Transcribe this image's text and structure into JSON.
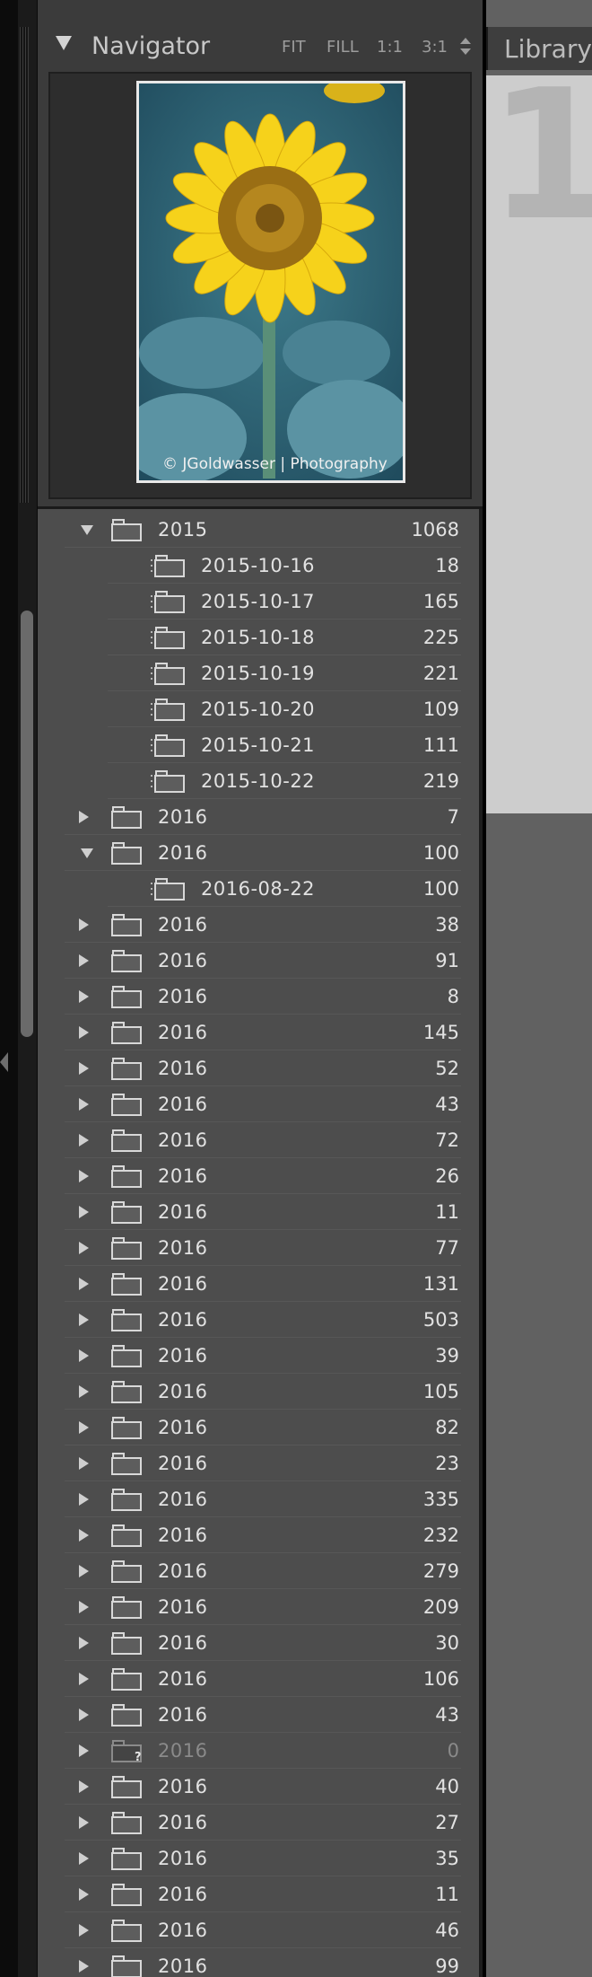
{
  "navigator": {
    "title": "Navigator",
    "zoom_levels": [
      "FIT",
      "FILL",
      "1:1",
      "3:1"
    ],
    "watermark": "© JGoldwasser | Photography"
  },
  "main": {
    "tab_label": "Library",
    "cell_number": "1"
  },
  "folders": [
    {
      "name": "2015",
      "count": "1068",
      "level": 0,
      "expanded": true
    },
    {
      "name": "2015-10-16",
      "count": "18",
      "level": 1
    },
    {
      "name": "2015-10-17",
      "count": "165",
      "level": 1
    },
    {
      "name": "2015-10-18",
      "count": "225",
      "level": 1
    },
    {
      "name": "2015-10-19",
      "count": "221",
      "level": 1
    },
    {
      "name": "2015-10-20",
      "count": "109",
      "level": 1
    },
    {
      "name": "2015-10-21",
      "count": "111",
      "level": 1
    },
    {
      "name": "2015-10-22",
      "count": "219",
      "level": 1
    },
    {
      "name": "2016",
      "count": "7",
      "level": 0,
      "expanded": false
    },
    {
      "name": "2016",
      "count": "100",
      "level": 0,
      "expanded": true
    },
    {
      "name": "2016-08-22",
      "count": "100",
      "level": 1
    },
    {
      "name": "2016",
      "count": "38",
      "level": 0,
      "expanded": false
    },
    {
      "name": "2016",
      "count": "91",
      "level": 0,
      "expanded": false
    },
    {
      "name": "2016",
      "count": "8",
      "level": 0,
      "expanded": false
    },
    {
      "name": "2016",
      "count": "145",
      "level": 0,
      "expanded": false
    },
    {
      "name": "2016",
      "count": "52",
      "level": 0,
      "expanded": false
    },
    {
      "name": "2016",
      "count": "43",
      "level": 0,
      "expanded": false
    },
    {
      "name": "2016",
      "count": "72",
      "level": 0,
      "expanded": false
    },
    {
      "name": "2016",
      "count": "26",
      "level": 0,
      "expanded": false
    },
    {
      "name": "2016",
      "count": "11",
      "level": 0,
      "expanded": false
    },
    {
      "name": "2016",
      "count": "77",
      "level": 0,
      "expanded": false
    },
    {
      "name": "2016",
      "count": "131",
      "level": 0,
      "expanded": false
    },
    {
      "name": "2016",
      "count": "503",
      "level": 0,
      "expanded": false
    },
    {
      "name": "2016",
      "count": "39",
      "level": 0,
      "expanded": false
    },
    {
      "name": "2016",
      "count": "105",
      "level": 0,
      "expanded": false
    },
    {
      "name": "2016",
      "count": "82",
      "level": 0,
      "expanded": false
    },
    {
      "name": "2016",
      "count": "23",
      "level": 0,
      "expanded": false
    },
    {
      "name": "2016",
      "count": "335",
      "level": 0,
      "expanded": false
    },
    {
      "name": "2016",
      "count": "232",
      "level": 0,
      "expanded": false
    },
    {
      "name": "2016",
      "count": "279",
      "level": 0,
      "expanded": false
    },
    {
      "name": "2016",
      "count": "209",
      "level": 0,
      "expanded": false
    },
    {
      "name": "2016",
      "count": "30",
      "level": 0,
      "expanded": false
    },
    {
      "name": "2016",
      "count": "106",
      "level": 0,
      "expanded": false
    },
    {
      "name": "2016",
      "count": "43",
      "level": 0,
      "expanded": false
    },
    {
      "name": "2016",
      "count": "0",
      "level": 0,
      "expanded": false,
      "missing": true
    },
    {
      "name": "2016",
      "count": "40",
      "level": 0,
      "expanded": false
    },
    {
      "name": "2016",
      "count": "27",
      "level": 0,
      "expanded": false
    },
    {
      "name": "2016",
      "count": "35",
      "level": 0,
      "expanded": false
    },
    {
      "name": "2016",
      "count": "11",
      "level": 0,
      "expanded": false
    },
    {
      "name": "2016",
      "count": "46",
      "level": 0,
      "expanded": false
    },
    {
      "name": "2016",
      "count": "99",
      "level": 0,
      "expanded": false
    }
  ]
}
